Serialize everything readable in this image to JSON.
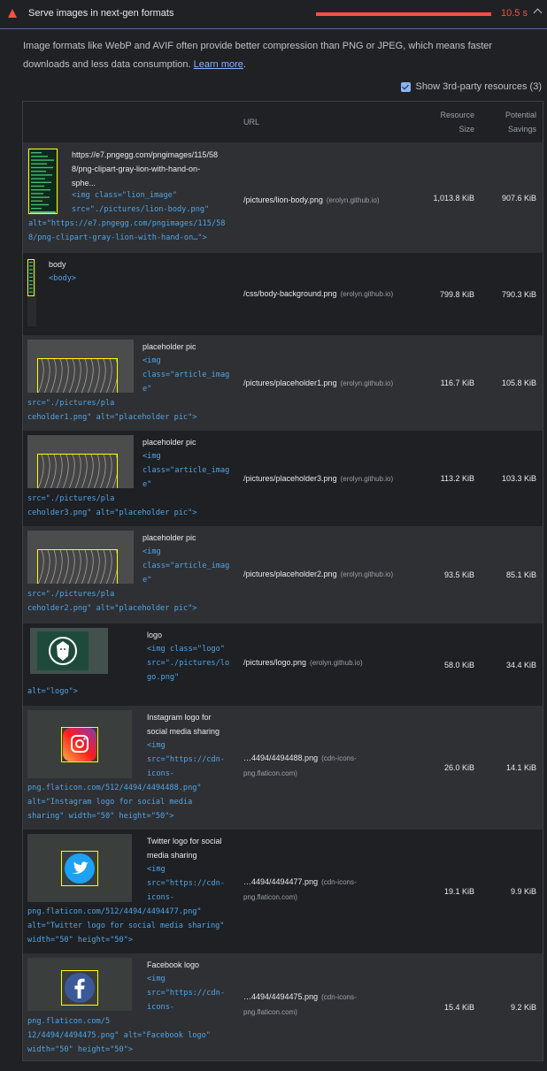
{
  "audit": {
    "title": "Serve images in next-gen formats",
    "time": "10.5 s",
    "description": "Image formats like WebP and AVIF often provide better compression than PNG or JPEG, which means faster downloads and less data consumption.",
    "learn_more": "Learn more",
    "third_party": "Show 3rd-party resources (3)"
  },
  "table": {
    "headers": {
      "url": "URL",
      "size1": "Resource",
      "size2": "Size",
      "sav1": "Potential",
      "sav2": "Savings"
    },
    "rows": [
      {
        "label_lines": [
          "https://e7.pngegg.com/pngimages/115/58",
          "8/png-clipart-gray-lion-with-hand-on-",
          "sphe..."
        ],
        "code_lines": [
          "<img class=\"lion_image\"",
          "src=\"./pictures/lion-body.png\"",
          "alt=\"https://e7.pngegg.com/pngimages/115/58",
          "8/png-clipart-gray-lion-with-hand-on…\">"
        ],
        "url": "/pictures/lion-body.png",
        "host": "(erolyn.github.io)",
        "size": "1,013.8 KiB",
        "savings": "907.6 KiB"
      },
      {
        "label_lines": [
          "body"
        ],
        "code_lines": [
          "<body>"
        ],
        "url": "/css/body-background.png",
        "host": "(erolyn.github.io)",
        "size": "799.8 KiB",
        "savings": "790.3 KiB"
      },
      {
        "label_lines": [
          "placeholder pic"
        ],
        "code_lines": [
          "<img",
          "class=\"article_imag",
          "e\"",
          "src=\"./pictures/pla",
          "ceholder1.png\" alt=\"placeholder pic\">"
        ],
        "url": "/pictures/placeholder1.png",
        "host": "(erolyn.github.io)",
        "size": "116.7 KiB",
        "savings": "105.8 KiB"
      },
      {
        "label_lines": [
          "placeholder pic"
        ],
        "code_lines": [
          "<img",
          "class=\"article_imag",
          "e\"",
          "src=\"./pictures/pla",
          "ceholder3.png\" alt=\"placeholder pic\">"
        ],
        "url": "/pictures/placeholder3.png",
        "host": "(erolyn.github.io)",
        "size": "113.2 KiB",
        "savings": "103.3 KiB"
      },
      {
        "label_lines": [
          "placeholder pic"
        ],
        "code_lines": [
          "<img",
          "class=\"article_imag",
          "e\"",
          "src=\"./pictures/pla",
          "ceholder2.png\" alt=\"placeholder pic\">"
        ],
        "url": "/pictures/placeholder2.png",
        "host": "(erolyn.github.io)",
        "size": "93.5 KiB",
        "savings": "85.1 KiB"
      },
      {
        "label_lines": [
          "logo"
        ],
        "code_lines": [
          "<img class=\"logo\"",
          "src=\"./pictures/lo",
          "go.png\"",
          "alt=\"logo\">"
        ],
        "url": "/pictures/logo.png",
        "host": "(erolyn.github.io)",
        "size": "58.0 KiB",
        "savings": "34.4 KiB"
      },
      {
        "label_lines": [
          "Instagram logo for",
          "social media sharing"
        ],
        "code_lines": [
          "<img",
          "src=\"https://cdn-",
          "icons-",
          "png.flaticon.com/512/4494/4494488.png\"",
          "alt=\"Instagram logo for social media",
          "sharing\" width=\"50\" height=\"50\">"
        ],
        "url": "…4494/4494488.png",
        "host": "(cdn-icons-",
        "host2": "png.flaticon.com)",
        "size": "26.0 KiB",
        "savings": "14.1 KiB"
      },
      {
        "label_lines": [
          "Twitter logo for social",
          "media sharing"
        ],
        "code_lines": [
          "<img",
          "src=\"https://cdn-",
          "icons-",
          "png.flaticon.com/512/4494/4494477.png\"",
          "alt=\"Twitter logo for social media sharing\"",
          "width=\"50\" height=\"50\">"
        ],
        "url": "…4494/4494477.png",
        "host": "(cdn-icons-",
        "host2": "png.flaticon.com)",
        "size": "19.1 KiB",
        "savings": "9.9 KiB"
      },
      {
        "label_lines": [
          "Facebook logo"
        ],
        "code_lines": [
          "<img",
          "src=\"https://cdn-",
          "icons-",
          "png.flaticon.com/5",
          "12/4494/4494475.png\" alt=\"Facebook logo\"",
          "width=\"50\" height=\"50\">"
        ],
        "url": "…4494/4494475.png",
        "host": "(cdn-icons-",
        "host2": "png.flaticon.com)",
        "size": "15.4 KiB",
        "savings": "9.2 KiB"
      }
    ]
  },
  "colors": {
    "fail": "#ff4e42",
    "link": "#8ab4f8",
    "code": "#4ea5e8"
  }
}
